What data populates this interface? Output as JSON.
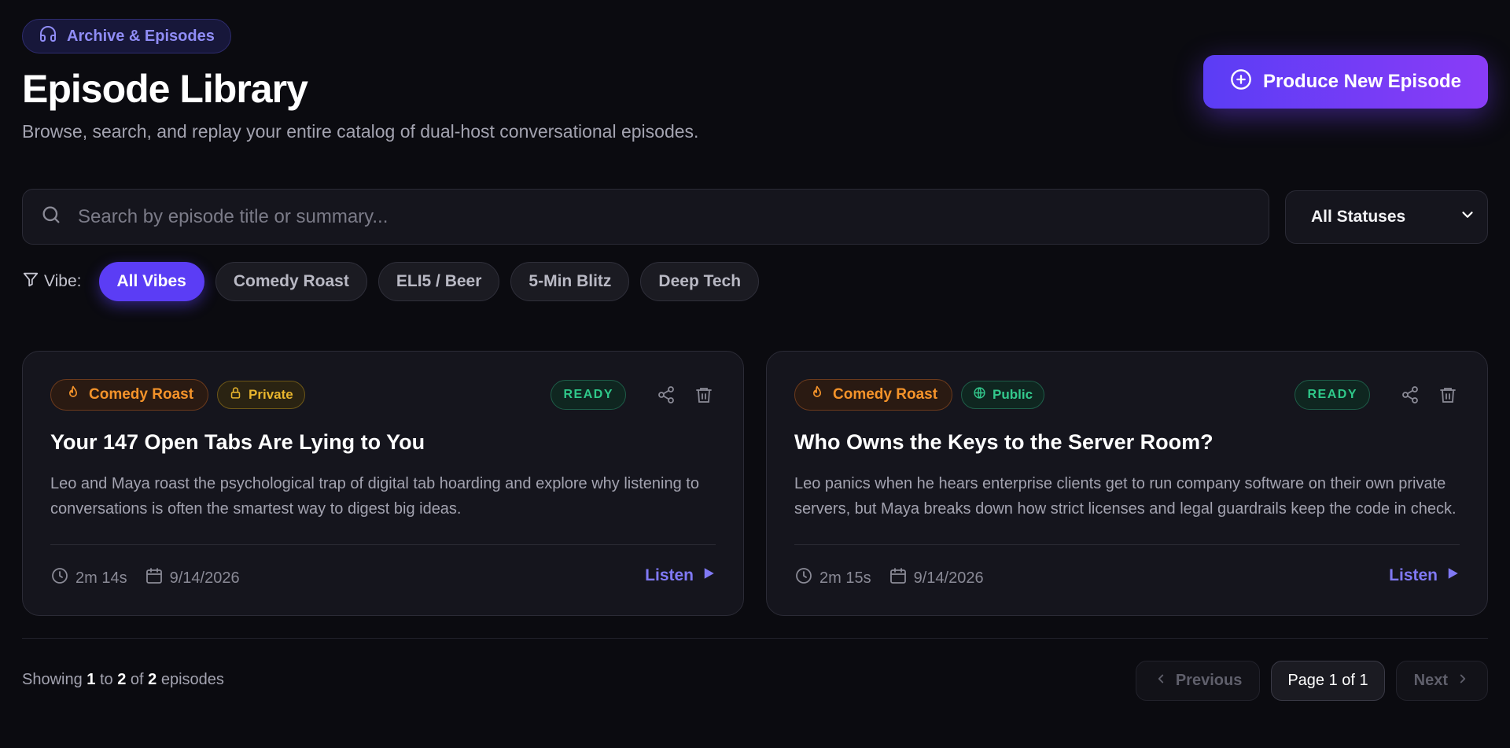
{
  "header": {
    "section_badge": "Archive & Episodes",
    "title": "Episode Library",
    "subtitle": "Browse, search, and replay your entire catalog of dual-host conversational episodes.",
    "produce_button": "Produce New Episode"
  },
  "search": {
    "placeholder": "Search by episode title or summary...",
    "value": ""
  },
  "status_filter": {
    "selected": "All Statuses"
  },
  "vibe_filter": {
    "label": "Vibe:",
    "chips": [
      {
        "label": "All Vibes",
        "active": true
      },
      {
        "label": "Comedy Roast",
        "active": false
      },
      {
        "label": "ELI5 / Beer",
        "active": false
      },
      {
        "label": "5-Min Blitz",
        "active": false
      },
      {
        "label": "Deep Tech",
        "active": false
      }
    ]
  },
  "episodes": [
    {
      "vibe": "Comedy Roast",
      "visibility": "Private",
      "status": "READY",
      "title": "Your 147 Open Tabs Are Lying to You",
      "summary": "Leo and Maya roast the psychological trap of digital tab hoarding and explore why listening to conversations is often the smartest way to digest big ideas.",
      "duration": "2m 14s",
      "date": "9/14/2026",
      "listen": "Listen"
    },
    {
      "vibe": "Comedy Roast",
      "visibility": "Public",
      "status": "READY",
      "title": "Who Owns the Keys to the Server Room?",
      "summary": "Leo panics when he hears enterprise clients get to run company software on their own private servers, but Maya breaks down how strict licenses and legal guardrails keep the code in check.",
      "duration": "2m 15s",
      "date": "9/14/2026",
      "listen": "Listen"
    }
  ],
  "footer": {
    "showing_prefix": "Showing",
    "from": "1",
    "to_word": "to",
    "to": "2",
    "of_word": "of",
    "total": "2",
    "suffix": "episodes",
    "previous": "Previous",
    "page_label": "Page 1 of 1",
    "next": "Next"
  },
  "colors": {
    "accent": "#5b3df5",
    "background": "#0b0b10",
    "card": "#15151d",
    "vibe_orange": "#f4932a",
    "private_amber": "#e8b52d",
    "ready_green": "#2fc98a",
    "listen_purple": "#8079f5"
  },
  "icons": {
    "section_badge": "headphones-icon",
    "produce_button": "plus-circle-icon",
    "search": "search-icon",
    "select": "chevron-down-icon",
    "vibe_label": "filter-icon",
    "vibe_tag": "flame-icon",
    "private": "lock-icon",
    "public": "globe-icon",
    "share": "share-icon",
    "delete": "trash-icon",
    "duration": "clock-icon",
    "date": "calendar-icon",
    "listen": "play-icon",
    "previous": "chevron-left-icon",
    "next": "chevron-right-icon"
  }
}
